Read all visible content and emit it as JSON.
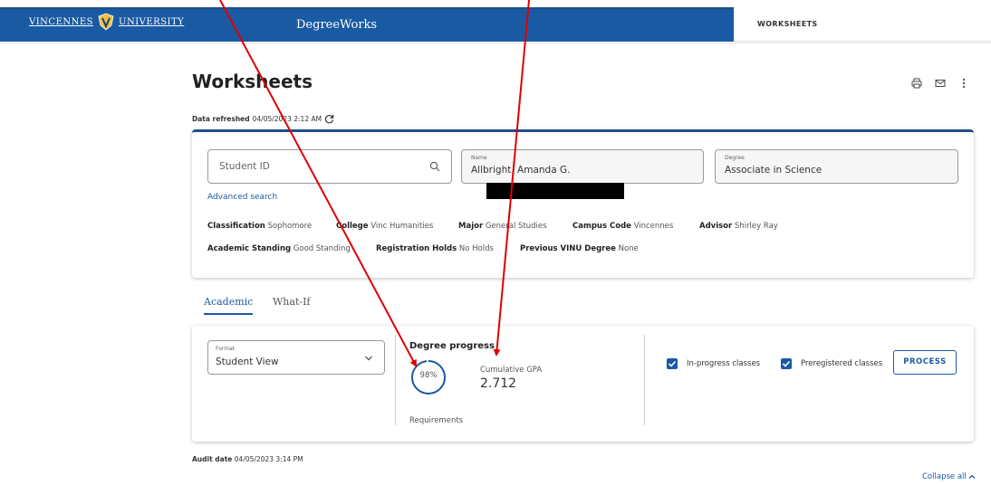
{
  "header": {
    "brand_left": "VINCENNES",
    "brand_right": "UNIVERSITY",
    "app_name": "DegreeWorks",
    "tab_label": "WORKSHEETS"
  },
  "page": {
    "title": "Worksheets",
    "refresh_label": "Data refreshed",
    "refresh_value": "04/05/2023 2:12 AM"
  },
  "student": {
    "id_placeholder": "Student ID",
    "name_label": "Name",
    "name_value": "Allbright, Amanda G.",
    "degree_label": "Degree",
    "degree_value": "Associate in Science",
    "advanced_search": "Advanced search",
    "row1": [
      {
        "label": "Classification",
        "value": "Sophomore"
      },
      {
        "label": "College",
        "value": "Vinc Humanities"
      },
      {
        "label": "Major",
        "value": "General Studies"
      },
      {
        "label": "Campus Code",
        "value": "Vincennes"
      },
      {
        "label": "Advisor",
        "value": "Shirley Ray"
      }
    ],
    "row2": [
      {
        "label": "Academic Standing",
        "value": "Good Standing"
      },
      {
        "label": "Registration Holds",
        "value": "No Holds"
      },
      {
        "label": "Previous VINU Degree",
        "value": "None"
      }
    ]
  },
  "tabs": {
    "academic": "Academic",
    "whatif": "What-If"
  },
  "progress": {
    "format_label": "Format",
    "format_value": "Student View",
    "title": "Degree progress",
    "percent_text": "98%",
    "percent": 98,
    "requirements_label": "Requirements",
    "gpa_label": "Cumulative GPA",
    "gpa_value": "2.712",
    "inprogress_label": "In-progress classes",
    "preregistered_label": "Preregistered classes",
    "process_label": "PROCESS"
  },
  "audit": {
    "label": "Audit date",
    "value": "04/05/2023 3:14 PM"
  },
  "collapse_label": "Collapse all",
  "colors": {
    "brand_blue": "#1a5aa3",
    "annotation_red": "#e00000"
  }
}
